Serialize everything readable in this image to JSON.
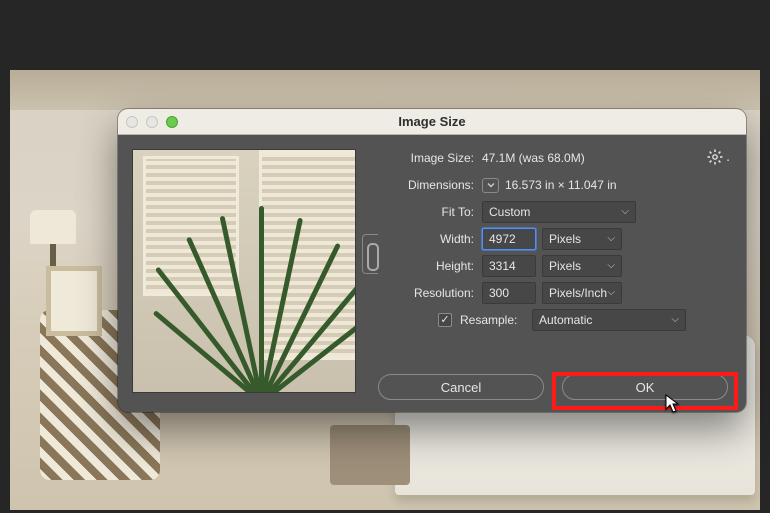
{
  "dialog": {
    "title": "Image Size",
    "info": {
      "label": "Image Size:",
      "value": "47.1M (was 68.0M)"
    },
    "dimensions": {
      "label": "Dimensions:",
      "value": "16.573 in  ×  11.047 in"
    },
    "fit": {
      "label": "Fit To:",
      "value": "Custom"
    },
    "width": {
      "label": "Width:",
      "value": "4972",
      "unit": "Pixels"
    },
    "height": {
      "label": "Height:",
      "value": "3314",
      "unit": "Pixels"
    },
    "resolution": {
      "label": "Resolution:",
      "value": "300",
      "unit": "Pixels/Inch"
    },
    "resample": {
      "label": "Resample:",
      "checked": true,
      "value": "Automatic"
    },
    "buttons": {
      "cancel": "Cancel",
      "ok": "OK"
    },
    "icons": {
      "gear": "gear-icon",
      "link": "link-icon",
      "disclosure": "chevron-down-icon"
    }
  }
}
